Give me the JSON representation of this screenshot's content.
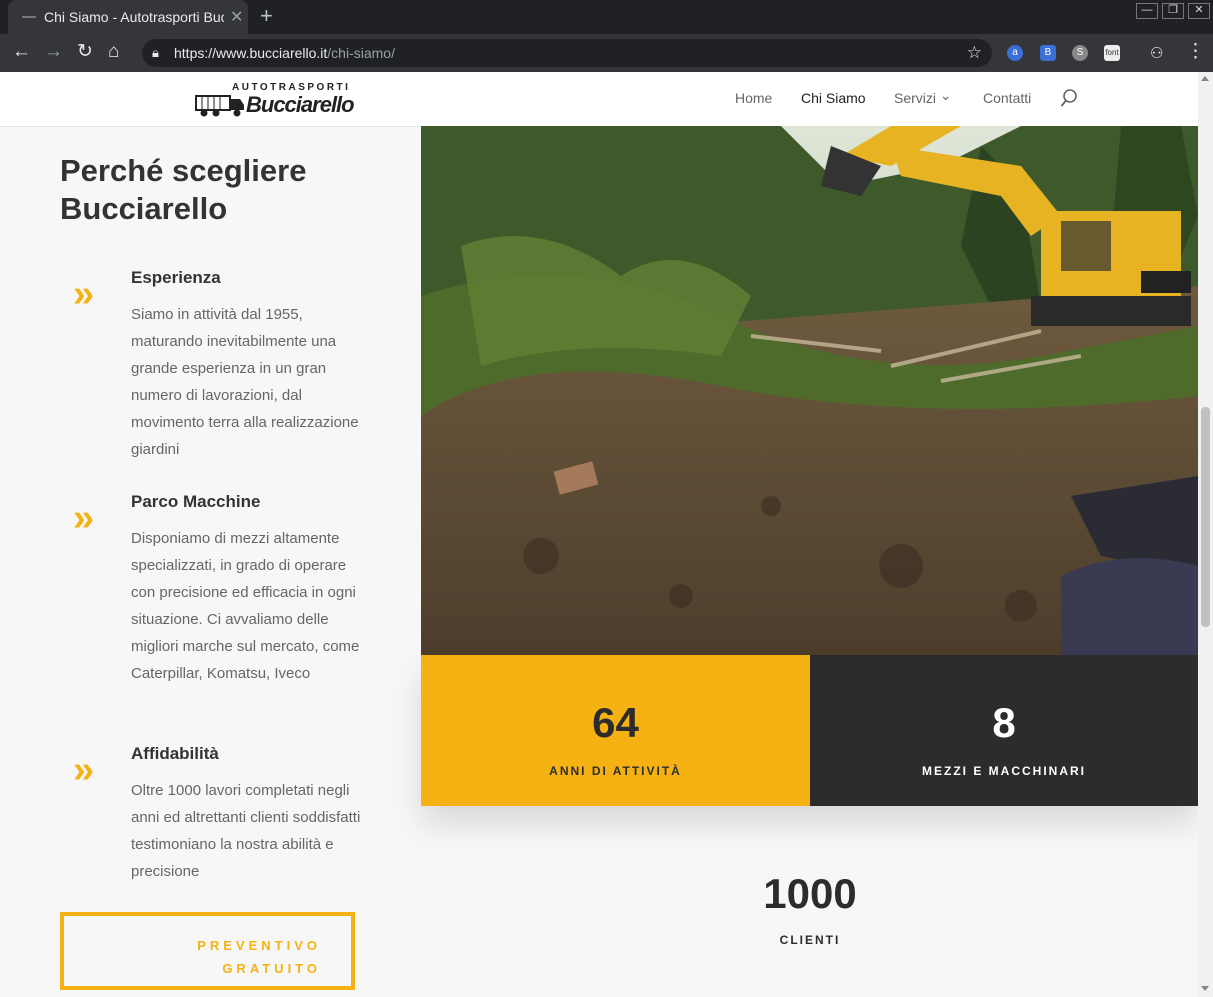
{
  "browser": {
    "tab_title": "Chi Siamo - Autotrasporti Bucciarello",
    "tab_close": "✕",
    "new_tab": "+",
    "url_host": "https://www.bucciarello.it",
    "url_path": "/chi-siamo/",
    "window_buttons": [
      "—",
      "❐",
      "✕"
    ],
    "extensions": [
      "a",
      "B",
      "S",
      "font"
    ]
  },
  "site": {
    "logo_top": "AUTOTRASPORTI",
    "logo_main": "Bucciarello",
    "nav": [
      {
        "label": "Home"
      },
      {
        "label": "Chi Siamo"
      },
      {
        "label": "Servizi"
      },
      {
        "label": "Contatti"
      }
    ],
    "servizi_chevron": "⌄"
  },
  "content": {
    "heading": "Perché scegliere Bucciarello",
    "features": [
      {
        "title": "Esperienza",
        "text": "Siamo in attività dal 1955, maturando inevitabilmente una grande esperienza in un gran numero di lavorazioni, dal movimento terra alla realizzazione giardini"
      },
      {
        "title": "Parco Macchine",
        "text": "Disponiamo di mezzi altamente specializzati, in grado di operare con precisione ed efficacia in ogni situazione. Ci avvaliamo delle migliori marche sul mercato, come Caterpillar, Komatsu, Iveco"
      },
      {
        "title": "Affidabilità",
        "text": "Oltre 1000 lavori completati negli anni ed altrettanti clienti soddisfatti testimoniano la nostra abilità e precisione"
      }
    ],
    "feature_icon": "»",
    "cta": "PREVENTIVO GRATUITO"
  },
  "stats": [
    {
      "number": "64",
      "label": "ANNI DI ATTIVITÀ"
    },
    {
      "number": "8",
      "label": "MEZZI E MACCHINARI"
    },
    {
      "number": "1000",
      "label": "CLIENTI"
    }
  ],
  "colors": {
    "accent": "#f5b212",
    "dark": "#2d2c2c",
    "text": "#666666",
    "heading": "#333333"
  }
}
